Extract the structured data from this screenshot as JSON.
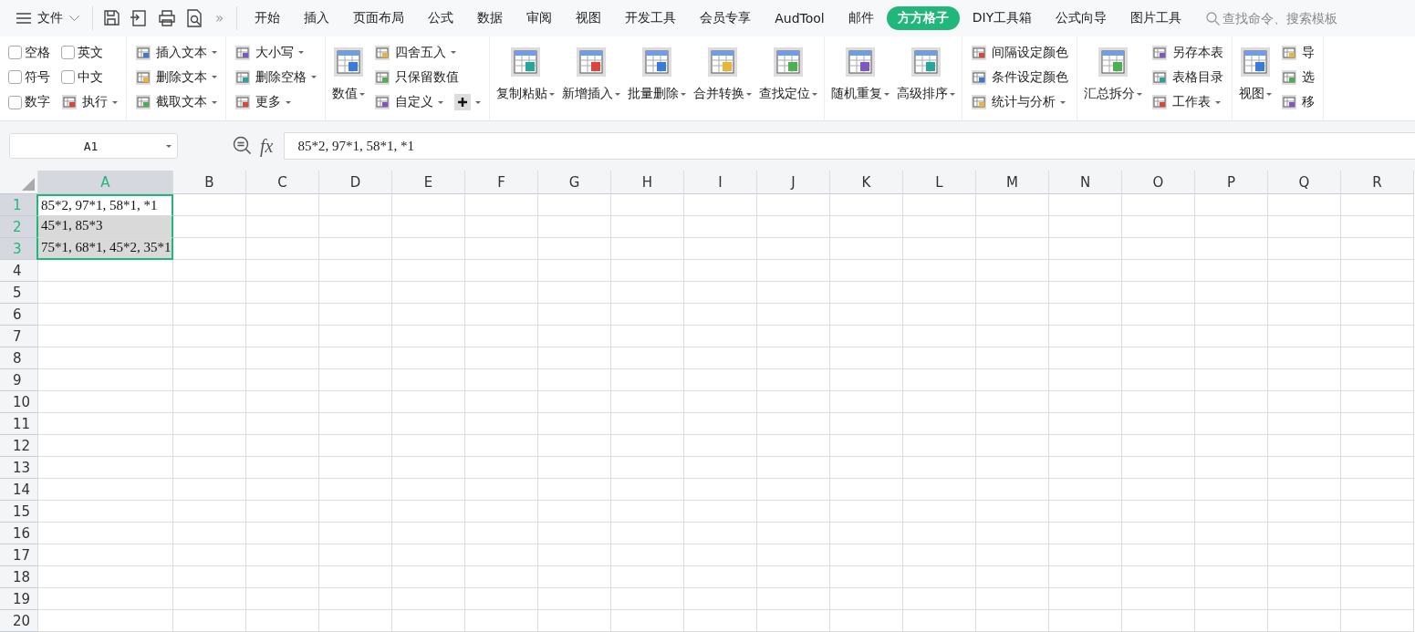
{
  "menu": {
    "label": "文件"
  },
  "quick_access": {
    "more": "»"
  },
  "tabs": [
    {
      "label": "开始",
      "selected": false
    },
    {
      "label": "插入",
      "selected": false
    },
    {
      "label": "页面布局",
      "selected": false
    },
    {
      "label": "公式",
      "selected": false
    },
    {
      "label": "数据",
      "selected": false
    },
    {
      "label": "审阅",
      "selected": false
    },
    {
      "label": "视图",
      "selected": false
    },
    {
      "label": "开发工具",
      "selected": false
    },
    {
      "label": "会员专享",
      "selected": false
    },
    {
      "label": "AudTool",
      "selected": false
    },
    {
      "label": "邮件",
      "selected": false
    },
    {
      "label": "方方格子",
      "selected": true
    },
    {
      "label": "DIY工具箱",
      "selected": false
    },
    {
      "label": "公式向导",
      "selected": false
    },
    {
      "label": "图片工具",
      "selected": false
    }
  ],
  "search": {
    "placeholder": "查找命令、搜索模板"
  },
  "ribbon": {
    "groups": [
      {
        "columns": [
          {
            "kind": "stack",
            "items": [
              {
                "kind": "check",
                "label": "空格",
                "checked": false
              },
              {
                "kind": "check",
                "label": "符号",
                "checked": false
              },
              {
                "kind": "check",
                "label": "数字",
                "checked": false
              }
            ]
          },
          {
            "kind": "stack",
            "items": [
              {
                "kind": "check",
                "label": "英文",
                "checked": false
              },
              {
                "kind": "check",
                "label": "中文",
                "checked": false
              },
              {
                "kind": "small",
                "label": "执行",
                "dropdown": true
              }
            ]
          }
        ]
      },
      {
        "columns": [
          {
            "kind": "stack",
            "items": [
              {
                "kind": "small",
                "label": "插入文本",
                "dropdown": true
              },
              {
                "kind": "small",
                "label": "删除文本",
                "dropdown": true
              },
              {
                "kind": "small",
                "label": "截取文本",
                "dropdown": true
              }
            ]
          }
        ]
      },
      {
        "columns": [
          {
            "kind": "stack",
            "items": [
              {
                "kind": "small",
                "label": "大小写",
                "dropdown": true
              },
              {
                "kind": "small",
                "label": "删除空格",
                "dropdown": true
              },
              {
                "kind": "small",
                "label": "更多",
                "dropdown": true
              }
            ]
          }
        ]
      },
      {
        "columns": [
          {
            "kind": "large",
            "label": "数值",
            "dropdown": true
          },
          {
            "kind": "stack",
            "items": [
              {
                "kind": "small",
                "label": "四舍五入",
                "dropdown": true
              },
              {
                "kind": "small",
                "label": "只保留数值",
                "dropdown": false
              },
              {
                "kind": "pair",
                "items": [
                  {
                    "kind": "small",
                    "label": "自定义",
                    "dropdown": true
                  },
                  {
                    "kind": "plus",
                    "dropdown": true
                  }
                ]
              }
            ]
          }
        ]
      },
      {
        "columns": [
          {
            "kind": "large",
            "label": "复制粘贴",
            "dropdown": true
          },
          {
            "kind": "large",
            "label": "新增插入",
            "dropdown": true
          },
          {
            "kind": "large",
            "label": "批量删除",
            "dropdown": true
          },
          {
            "kind": "large",
            "label": "合并转换",
            "dropdown": true
          },
          {
            "kind": "large",
            "label": "查找定位",
            "dropdown": true
          }
        ]
      },
      {
        "columns": [
          {
            "kind": "large",
            "label": "随机重复",
            "dropdown": true
          },
          {
            "kind": "large",
            "label": "高级排序",
            "dropdown": true
          }
        ]
      },
      {
        "columns": [
          {
            "kind": "stack",
            "items": [
              {
                "kind": "small",
                "label": "间隔设定颜色",
                "dropdown": false
              },
              {
                "kind": "small",
                "label": "条件设定颜色",
                "dropdown": false
              },
              {
                "kind": "small",
                "label": "统计与分析",
                "dropdown": true
              }
            ]
          }
        ]
      },
      {
        "columns": [
          {
            "kind": "large",
            "label": "汇总拆分",
            "dropdown": true
          },
          {
            "kind": "stack",
            "items": [
              {
                "kind": "small",
                "label": "另存本表",
                "dropdown": false
              },
              {
                "kind": "small",
                "label": "表格目录",
                "dropdown": false
              },
              {
                "kind": "small",
                "label": "工作表",
                "dropdown": true
              }
            ]
          }
        ]
      },
      {
        "columns": [
          {
            "kind": "large",
            "label": "视图",
            "dropdown": true
          },
          {
            "kind": "stack",
            "items": [
              {
                "kind": "small",
                "label": "导",
                "dropdown": false
              },
              {
                "kind": "small",
                "label": "选",
                "dropdown": false
              },
              {
                "kind": "small",
                "label": "移",
                "dropdown": false
              }
            ]
          }
        ]
      }
    ]
  },
  "formula_bar": {
    "name_box": "A1",
    "fx": "fx",
    "value": "85*2, 97*1, 58*1, *1"
  },
  "sheet": {
    "columns": [
      {
        "label": "A",
        "selected": true
      },
      {
        "label": "B",
        "selected": false
      },
      {
        "label": "C",
        "selected": false
      },
      {
        "label": "D",
        "selected": false
      },
      {
        "label": "E",
        "selected": false
      },
      {
        "label": "F",
        "selected": false
      },
      {
        "label": "G",
        "selected": false
      },
      {
        "label": "H",
        "selected": false
      },
      {
        "label": "I",
        "selected": false
      },
      {
        "label": "J",
        "selected": false
      },
      {
        "label": "K",
        "selected": false
      },
      {
        "label": "L",
        "selected": false
      },
      {
        "label": "M",
        "selected": false
      },
      {
        "label": "N",
        "selected": false
      },
      {
        "label": "O",
        "selected": false
      },
      {
        "label": "P",
        "selected": false
      },
      {
        "label": "Q",
        "selected": false
      },
      {
        "label": "R",
        "selected": false
      }
    ],
    "rows": [
      {
        "label": "1",
        "selected": true,
        "cells": [
          {
            "text": "85*2, 97*1, 58*1, *1",
            "selected": true,
            "active": true
          }
        ]
      },
      {
        "label": "2",
        "selected": true,
        "cells": [
          {
            "text": "45*1, 85*3",
            "selected": true,
            "active": false
          }
        ]
      },
      {
        "label": "3",
        "selected": true,
        "cells": [
          {
            "text": "75*1, 68*1, 45*2, 35*1",
            "selected": true,
            "active": false
          }
        ]
      },
      {
        "label": "4",
        "selected": false,
        "cells": []
      },
      {
        "label": "5",
        "selected": false,
        "cells": []
      },
      {
        "label": "6",
        "selected": false,
        "cells": []
      },
      {
        "label": "7",
        "selected": false,
        "cells": []
      },
      {
        "label": "8",
        "selected": false,
        "cells": []
      },
      {
        "label": "9",
        "selected": false,
        "cells": []
      },
      {
        "label": "10",
        "selected": false,
        "cells": []
      },
      {
        "label": "11",
        "selected": false,
        "cells": []
      },
      {
        "label": "12",
        "selected": false,
        "cells": []
      },
      {
        "label": "13",
        "selected": false,
        "cells": []
      },
      {
        "label": "14",
        "selected": false,
        "cells": []
      },
      {
        "label": "15",
        "selected": false,
        "cells": []
      },
      {
        "label": "16",
        "selected": false,
        "cells": []
      },
      {
        "label": "17",
        "selected": false,
        "cells": []
      },
      {
        "label": "18",
        "selected": false,
        "cells": []
      },
      {
        "label": "19",
        "selected": false,
        "cells": []
      },
      {
        "label": "20",
        "selected": false,
        "cells": []
      }
    ]
  }
}
